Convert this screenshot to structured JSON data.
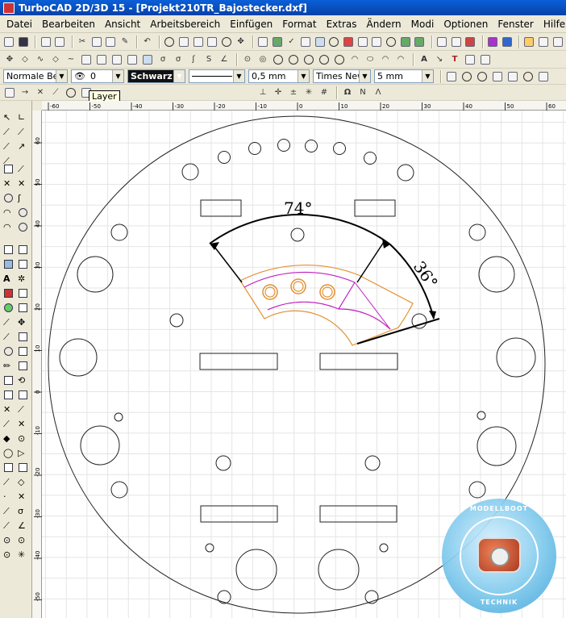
{
  "window": {
    "title": "TurboCAD 2D/3D 15 - [Projekt210TR_Bajostecker.dxf]"
  },
  "menu": [
    "Datei",
    "Bearbeiten",
    "Ansicht",
    "Arbeitsbereich",
    "Einfügen",
    "Format",
    "Extras",
    "Ändern",
    "Modi",
    "Optionen",
    "Fenster",
    "Hilfe"
  ],
  "properties": {
    "style": "Normale Be",
    "layer": "0",
    "color": "Schwarz",
    "line_width": "0,5 mm",
    "font": "Times New",
    "font_size": "5 mm"
  },
  "tooltip": "Layer",
  "ruler_top": [
    "-60",
    "-50",
    "-40",
    "-30",
    "-20",
    "-10",
    "0",
    "10",
    "20",
    "30",
    "40",
    "50",
    "60"
  ],
  "ruler_left": [
    "60",
    "50",
    "40",
    "30",
    "20",
    "10",
    "0",
    "-10",
    "-20",
    "-30",
    "-40",
    "-50"
  ],
  "drawing": {
    "dim_angle_1": "74°",
    "dim_angle_2": "36°"
  },
  "logo": {
    "top_text": "MODELLBOOT",
    "bottom_text": "TECHNIK"
  }
}
